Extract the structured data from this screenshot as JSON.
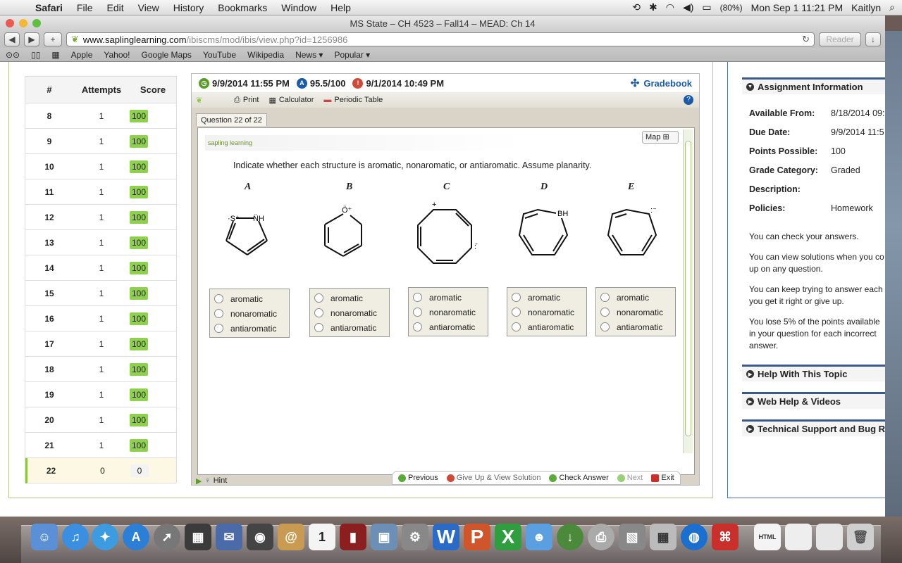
{
  "menubar": {
    "app": "Safari",
    "items": [
      "File",
      "Edit",
      "View",
      "History",
      "Bookmarks",
      "Window",
      "Help"
    ],
    "battery": "(80%)",
    "datetime": "Mon Sep 1  11:21 PM",
    "user": "Kaitlyn"
  },
  "window": {
    "title": "MS State – CH 4523 – Fall14 – MEAD: Ch 14",
    "url_host": "www.saplinglearning.com",
    "url_path": "/ibiscms/mod/ibis/view.php?id=1256986",
    "reader": "Reader"
  },
  "bookmarks": [
    "Apple",
    "Yahoo!",
    "Google Maps",
    "YouTube",
    "Wikipedia",
    "News ▾",
    "Popular ▾"
  ],
  "attempts": {
    "headers": [
      "#",
      "Attempts",
      "Score"
    ],
    "rows": [
      {
        "n": "8",
        "a": "1",
        "s": "100"
      },
      {
        "n": "9",
        "a": "1",
        "s": "100"
      },
      {
        "n": "10",
        "a": "1",
        "s": "100"
      },
      {
        "n": "11",
        "a": "1",
        "s": "100"
      },
      {
        "n": "12",
        "a": "1",
        "s": "100"
      },
      {
        "n": "13",
        "a": "1",
        "s": "100"
      },
      {
        "n": "14",
        "a": "1",
        "s": "100"
      },
      {
        "n": "15",
        "a": "1",
        "s": "100"
      },
      {
        "n": "16",
        "a": "1",
        "s": "100"
      },
      {
        "n": "17",
        "a": "1",
        "s": "100"
      },
      {
        "n": "18",
        "a": "1",
        "s": "100"
      },
      {
        "n": "19",
        "a": "1",
        "s": "100"
      },
      {
        "n": "20",
        "a": "1",
        "s": "100"
      },
      {
        "n": "21",
        "a": "1",
        "s": "100"
      },
      {
        "n": "22",
        "a": "0",
        "s": "0"
      }
    ]
  },
  "question": {
    "due": "9/9/2014 11:55 PM",
    "score": "95.5/100",
    "date": "9/1/2014 10:49 PM",
    "gradebook": "Gradebook",
    "tools": {
      "print": "Print",
      "calculator": "Calculator",
      "periodic": "Periodic Table"
    },
    "tab": "Question 22 of 22",
    "logo": "sapling learning",
    "map": "Map",
    "prompt": "Indicate whether each structure is aromatic, nonaromatic, or antiaromatic. Assume planarity.",
    "labels": [
      "A",
      "B",
      "C",
      "D",
      "E"
    ],
    "options": [
      "aromatic",
      "nonaromatic",
      "antiaromatic"
    ],
    "hint": "Hint",
    "nav": {
      "previous": "Previous",
      "giveup": "Give Up & View Solution",
      "check": "Check Answer",
      "next": "Next",
      "exit": "Exit"
    }
  },
  "assignment": {
    "heading": "Assignment Information",
    "fields": [
      {
        "k": "Available From:",
        "v": "8/18/2014 09:"
      },
      {
        "k": "Due Date:",
        "v": "9/9/2014 11:5"
      },
      {
        "k": "Points Possible:",
        "v": "100"
      },
      {
        "k": "Grade Category:",
        "v": "Graded"
      },
      {
        "k": "Description:",
        "v": ""
      },
      {
        "k": "Policies:",
        "v": "Homework"
      }
    ],
    "notes": [
      "You can check your answers.",
      "You can view solutions when you co up on any question.",
      "You can keep trying to answer each you get it right or give up.",
      "You lose 5% of the points available in your question for each incorrect answer."
    ],
    "sections": [
      "Help With This Topic",
      "Web Help & Videos",
      "Technical Support and Bug R"
    ]
  }
}
